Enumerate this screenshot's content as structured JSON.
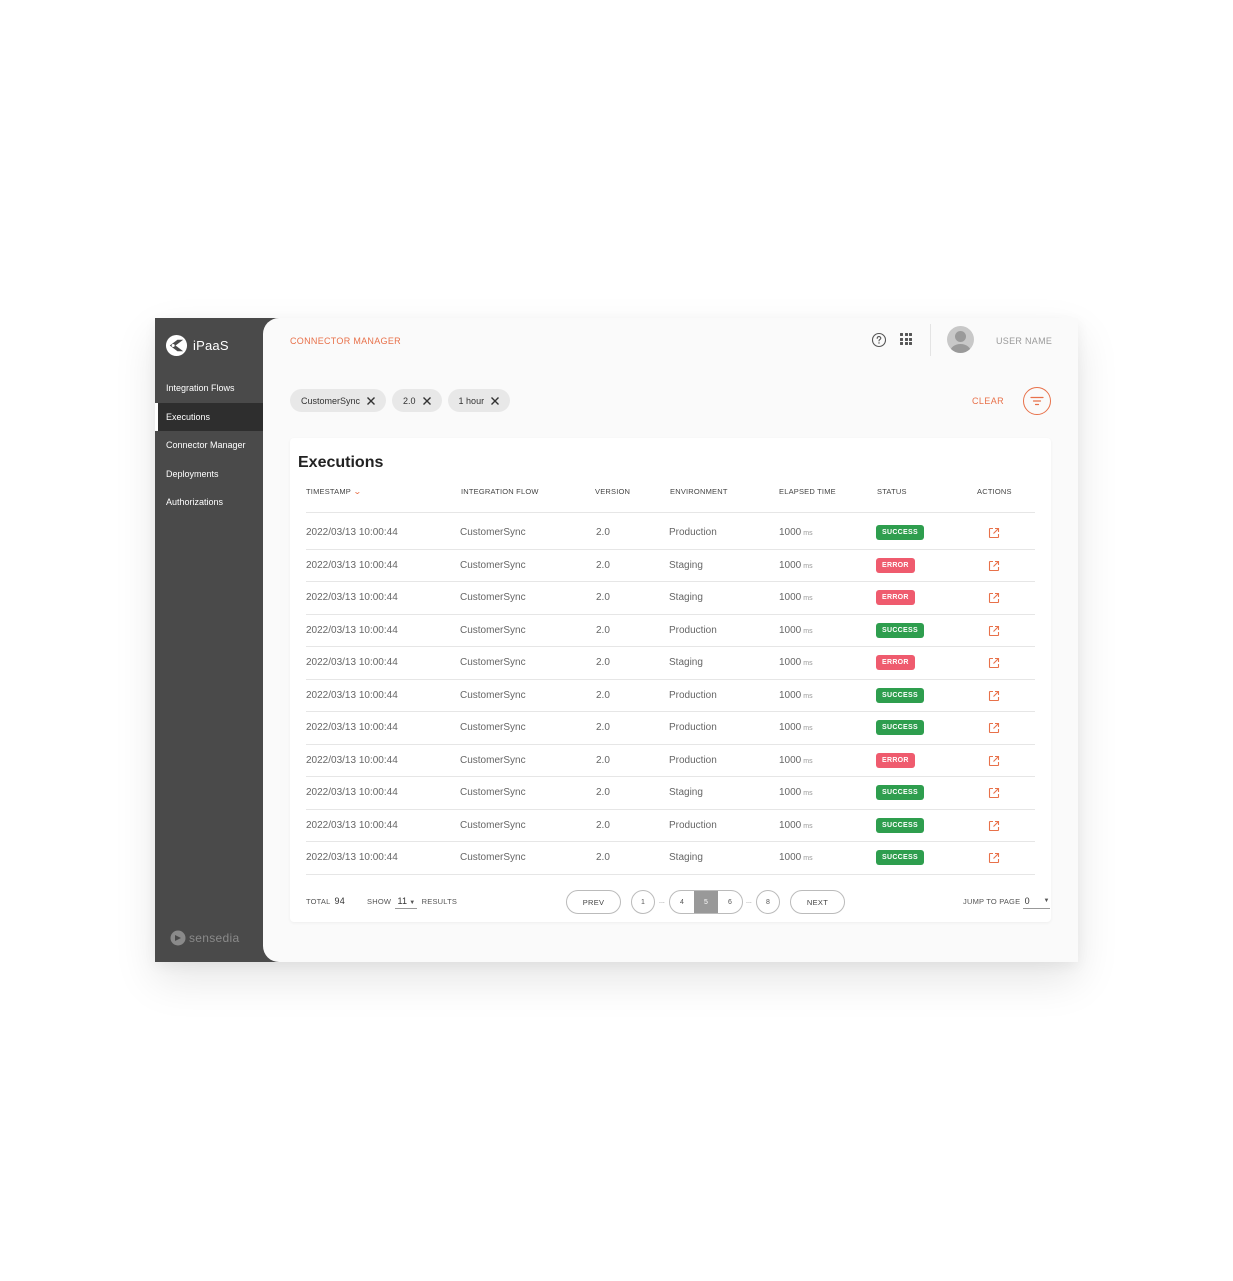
{
  "app": {
    "name": "iPaaS",
    "brand": "sensedia"
  },
  "sidebar": {
    "items": [
      {
        "label": "Integration Flows",
        "active": false
      },
      {
        "label": "Executions",
        "active": true
      },
      {
        "label": "Connector Manager",
        "active": false
      },
      {
        "label": "Deployments",
        "active": false
      },
      {
        "label": "Authorizations",
        "active": false
      }
    ]
  },
  "header": {
    "title": "CONNECTOR MANAGER",
    "user_name": "USER NAME"
  },
  "filters": {
    "chips": [
      "CustomerSync",
      "2.0",
      "1 hour"
    ],
    "clear_label": "CLEAR"
  },
  "table": {
    "title": "Executions",
    "columns": [
      "TIMESTAMP",
      "INTEGRATION FLOW",
      "VERSION",
      "ENVIRONMENT",
      "ELAPSED TIME",
      "STATUS",
      "ACTIONS"
    ],
    "unit": "ms",
    "rows": [
      {
        "timestamp": "2022/03/13 10:00:44",
        "flow": "CustomerSync",
        "version": "2.0",
        "environment": "Production",
        "elapsed": "1000",
        "status": "SUCCESS"
      },
      {
        "timestamp": "2022/03/13 10:00:44",
        "flow": "CustomerSync",
        "version": "2.0",
        "environment": "Staging",
        "elapsed": "1000",
        "status": "ERROR"
      },
      {
        "timestamp": "2022/03/13 10:00:44",
        "flow": "CustomerSync",
        "version": "2.0",
        "environment": "Staging",
        "elapsed": "1000",
        "status": "ERROR"
      },
      {
        "timestamp": "2022/03/13 10:00:44",
        "flow": "CustomerSync",
        "version": "2.0",
        "environment": "Production",
        "elapsed": "1000",
        "status": "SUCCESS"
      },
      {
        "timestamp": "2022/03/13 10:00:44",
        "flow": "CustomerSync",
        "version": "2.0",
        "environment": "Staging",
        "elapsed": "1000",
        "status": "ERROR"
      },
      {
        "timestamp": "2022/03/13 10:00:44",
        "flow": "CustomerSync",
        "version": "2.0",
        "environment": "Production",
        "elapsed": "1000",
        "status": "SUCCESS"
      },
      {
        "timestamp": "2022/03/13 10:00:44",
        "flow": "CustomerSync",
        "version": "2.0",
        "environment": "Production",
        "elapsed": "1000",
        "status": "SUCCESS"
      },
      {
        "timestamp": "2022/03/13 10:00:44",
        "flow": "CustomerSync",
        "version": "2.0",
        "environment": "Production",
        "elapsed": "1000",
        "status": "ERROR"
      },
      {
        "timestamp": "2022/03/13 10:00:44",
        "flow": "CustomerSync",
        "version": "2.0",
        "environment": "Staging",
        "elapsed": "1000",
        "status": "SUCCESS"
      },
      {
        "timestamp": "2022/03/13 10:00:44",
        "flow": "CustomerSync",
        "version": "2.0",
        "environment": "Production",
        "elapsed": "1000",
        "status": "SUCCESS"
      },
      {
        "timestamp": "2022/03/13 10:00:44",
        "flow": "CustomerSync",
        "version": "2.0",
        "environment": "Staging",
        "elapsed": "1000",
        "status": "SUCCESS"
      }
    ]
  },
  "footer": {
    "total_label": "TOTAL",
    "total_value": "94",
    "show_label": "SHOW",
    "show_value": "11",
    "results_label": "RESULTS",
    "prev_label": "PREV",
    "next_label": "NEXT",
    "pages": {
      "first": "1",
      "group": [
        "4",
        "5",
        "6"
      ],
      "current": "5",
      "last": "8",
      "ellipsis": "..."
    },
    "jump_label": "JUMP TO PAGE",
    "jump_value": "0"
  },
  "colors": {
    "accent": "#e8714a",
    "success": "#2e9e4e",
    "error": "#ef5b6e",
    "sidebar": "#4a4a4a"
  },
  "icons": {
    "logo": "ipaas-logo-icon",
    "help": "help-circle-icon",
    "apps": "apps-grid-icon",
    "filter": "filter-icon",
    "chip_remove": "close-icon",
    "action": "open-external-icon",
    "sort": "chevron-down-icon"
  }
}
